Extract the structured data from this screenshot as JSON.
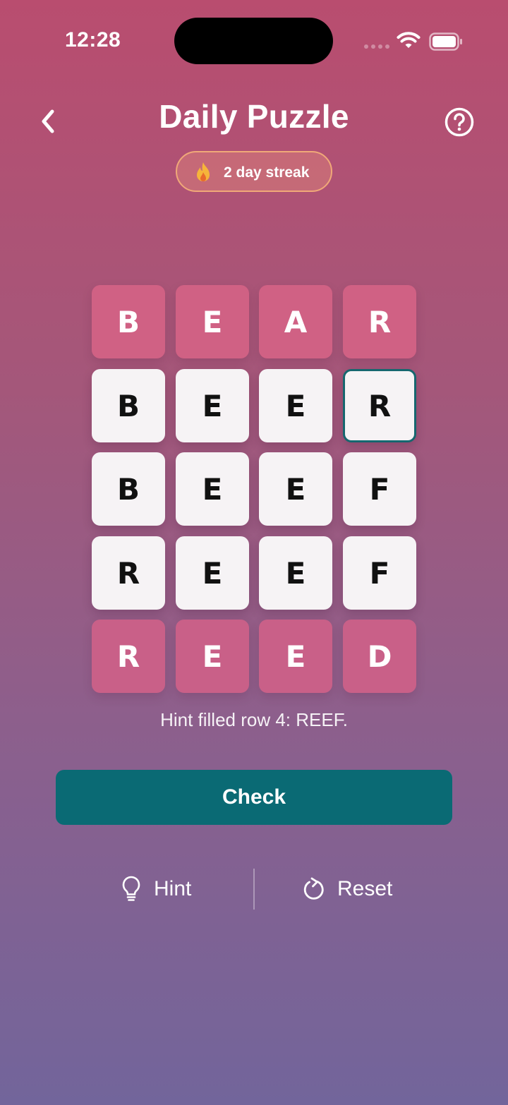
{
  "status_bar": {
    "time": "12:28"
  },
  "header": {
    "title": "Daily Puzzle",
    "back_icon": "chevron-left-icon",
    "help_icon": "question-circle-icon"
  },
  "streak": {
    "label": "2 day streak",
    "icon": "flame-icon"
  },
  "grid": {
    "rows": [
      [
        "B",
        "E",
        "A",
        "R"
      ],
      [
        "B",
        "E",
        "E",
        "R"
      ],
      [
        "B",
        "E",
        "E",
        "F"
      ],
      [
        "R",
        "E",
        "E",
        "F"
      ],
      [
        "R",
        "E",
        "E",
        "D"
      ]
    ],
    "fixed_rows": [
      0,
      4
    ],
    "selected_cell": [
      1,
      3
    ]
  },
  "hint_message": "Hint filled row 4: REEF.",
  "actions": {
    "check_label": "Check",
    "hint_label": "Hint",
    "reset_label": "Reset"
  },
  "colors": {
    "fixed_tile": "#d06184",
    "input_tile": "#f6f3f5",
    "accent": "#0a6a74",
    "streak_border": "#f0a878"
  }
}
